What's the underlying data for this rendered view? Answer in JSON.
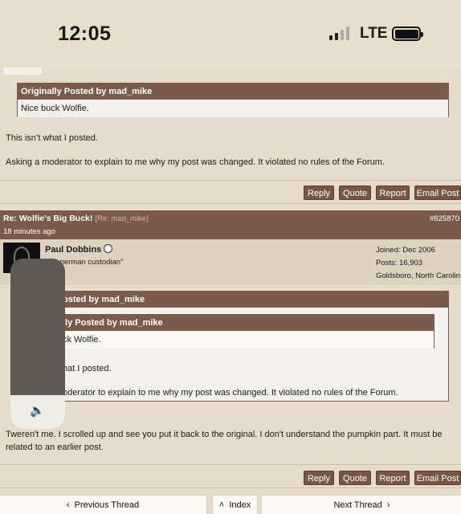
{
  "status": {
    "time": "12:05",
    "network": "LTE"
  },
  "post1": {
    "quote_header": "Originally Posted by mad_mike",
    "quote_body": "Nice buck Wolfie.",
    "line1": "This isn’t what I posted.",
    "line2": "Asking a moderator to explain to me why my post was changed. It violated no rules of the Forum."
  },
  "buttons": {
    "reply": "Reply",
    "quote": "Quote",
    "report": "Report",
    "email": "Email Post"
  },
  "post2": {
    "title": "Re: Wolfie's Big Buck!",
    "re_tag": "[Re: mad_mike]",
    "time": "18 minutes ago",
    "post_id": "#825870",
    "username": "Paul Dobbins",
    "user_title": "opperman custodian\"",
    "joined": "Joined: Dec 2006",
    "posts": "Posts: 16,903",
    "location": "Goldsboro, North Carolin",
    "outer_quote_header": "osted by mad_mike",
    "inner_quote_header": "lly Posted by mad_mike",
    "inner_quote_body": "ck Wolfie.",
    "quoted_line1": "hat I posted.",
    "quoted_line2": "oderator to explain to me why my post was changed. It violated no rules of the Forum.",
    "body_line1": "Tweren't me. I scrolled up and see you put it back to the original. I don't understand the pumpkin part. It must be",
    "body_line2": "related to an earlier post."
  },
  "nav": {
    "previous": "Previous Thread",
    "index": "Index",
    "next": "Next Thread"
  }
}
